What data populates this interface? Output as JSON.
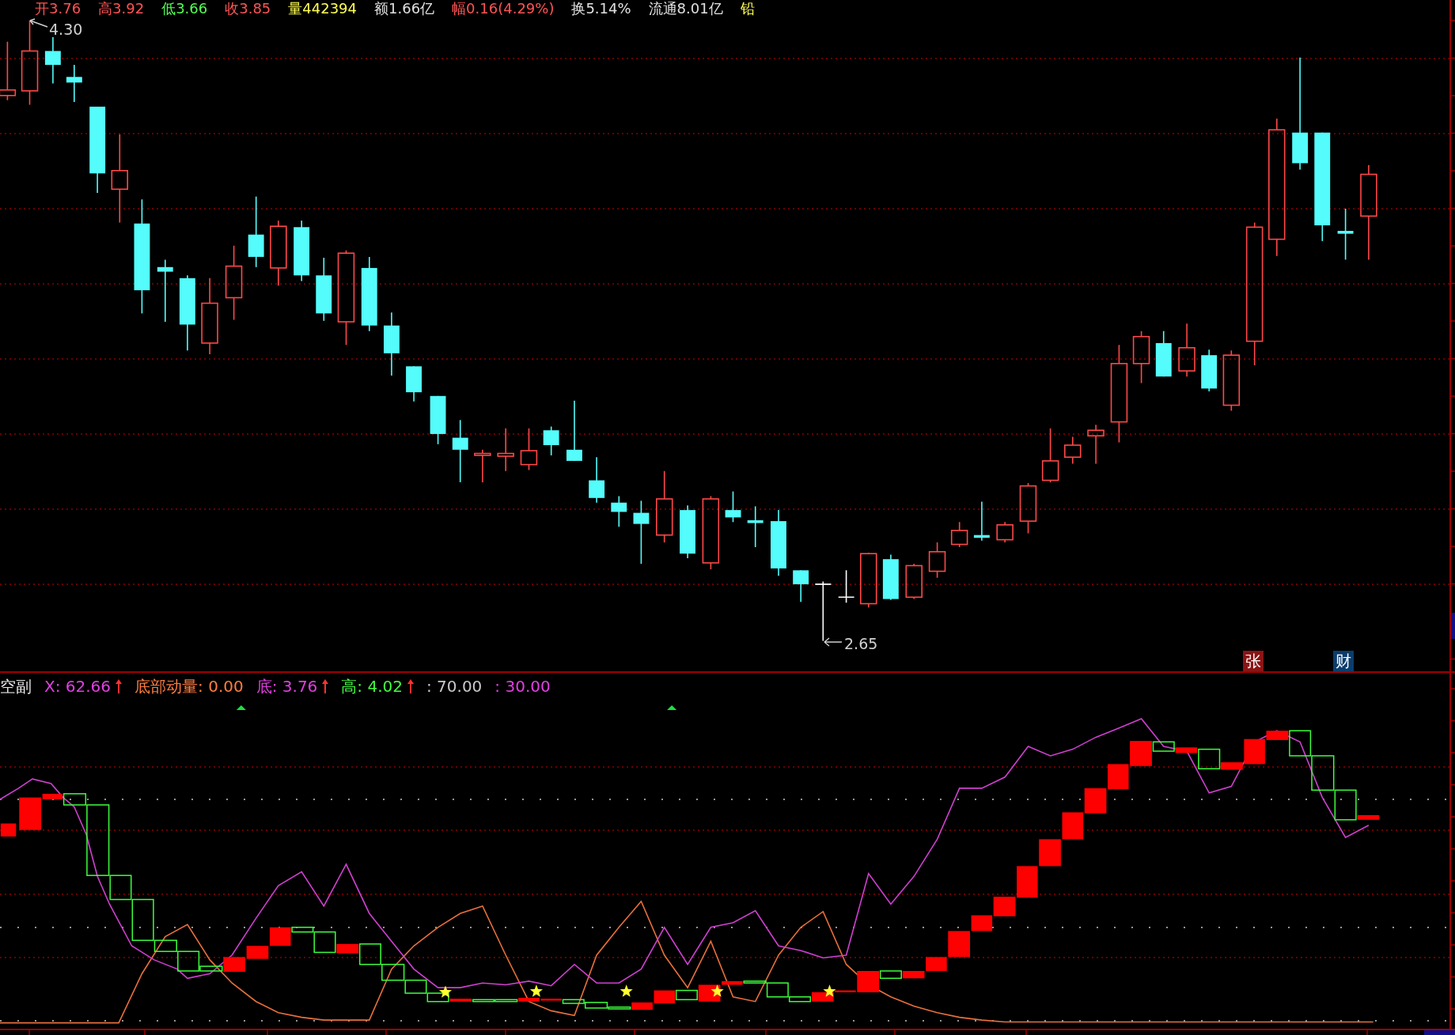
{
  "quote_bar": [
    {
      "text": "开3.76",
      "color": "#ff5454"
    },
    {
      "text": "高3.92",
      "color": "#ff5454"
    },
    {
      "text": "低3.66",
      "color": "#54ff54"
    },
    {
      "text": "收3.85",
      "color": "#ff5454"
    },
    {
      "text": "量442394",
      "color": "#ffff54"
    },
    {
      "text": "额1.66亿",
      "color": "#e0e0e0"
    },
    {
      "text": "幅0.16(4.29%)",
      "color": "#ff5454"
    },
    {
      "text": "换5.14%",
      "color": "#e0e0e0"
    },
    {
      "text": "流通8.01亿",
      "color": "#e0e0e0"
    },
    {
      "text": "铅",
      "color": "#ffff54"
    }
  ],
  "price_chart": {
    "high_label": "4.30",
    "low_label": "2.65",
    "badges": [
      {
        "text": "张",
        "color": "#8c1414"
      },
      {
        "text": "财",
        "color": "#0c3c6c"
      }
    ]
  },
  "indicator": {
    "name": "空副",
    "values": [
      {
        "text": "X: 62.66",
        "color": "#e040e0",
        "arrow_up": true
      },
      {
        "text": "底部动量: 0.00",
        "color": "#ff7c40",
        "arrow_up": false
      },
      {
        "text": "底: 3.76",
        "color": "#e040e0",
        "arrow_up": true
      },
      {
        "text": "高: 4.02",
        "color": "#40ff40",
        "arrow_up": true
      },
      {
        "text": ": 70.00",
        "color": "#c8c8c8",
        "arrow_up": false
      },
      {
        "text": ": 30.00",
        "color": "#e040e0",
        "arrow_up": false
      }
    ]
  }
}
